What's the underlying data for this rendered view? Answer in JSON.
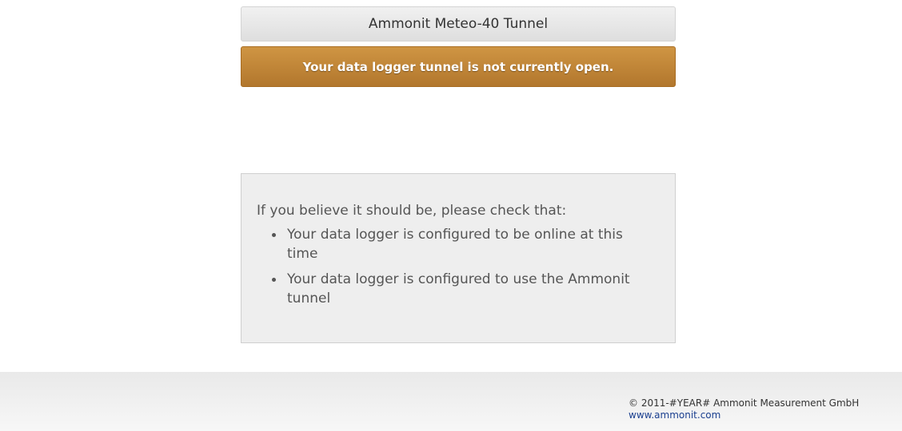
{
  "header": {
    "title": "Ammonit Meteo-40 Tunnel"
  },
  "alert": {
    "message": "Your data logger tunnel is not currently open.",
    "color": "#c2863a"
  },
  "info": {
    "intro": "If you believe it should be, please check that:",
    "items": [
      "Your data logger is configured to be online at this time",
      "Your data logger is configured to use the Ammonit tunnel"
    ]
  },
  "footer": {
    "copyright": "© 2011-#YEAR# Ammonit Measurement GmbH",
    "link": "www.ammonit.com"
  }
}
